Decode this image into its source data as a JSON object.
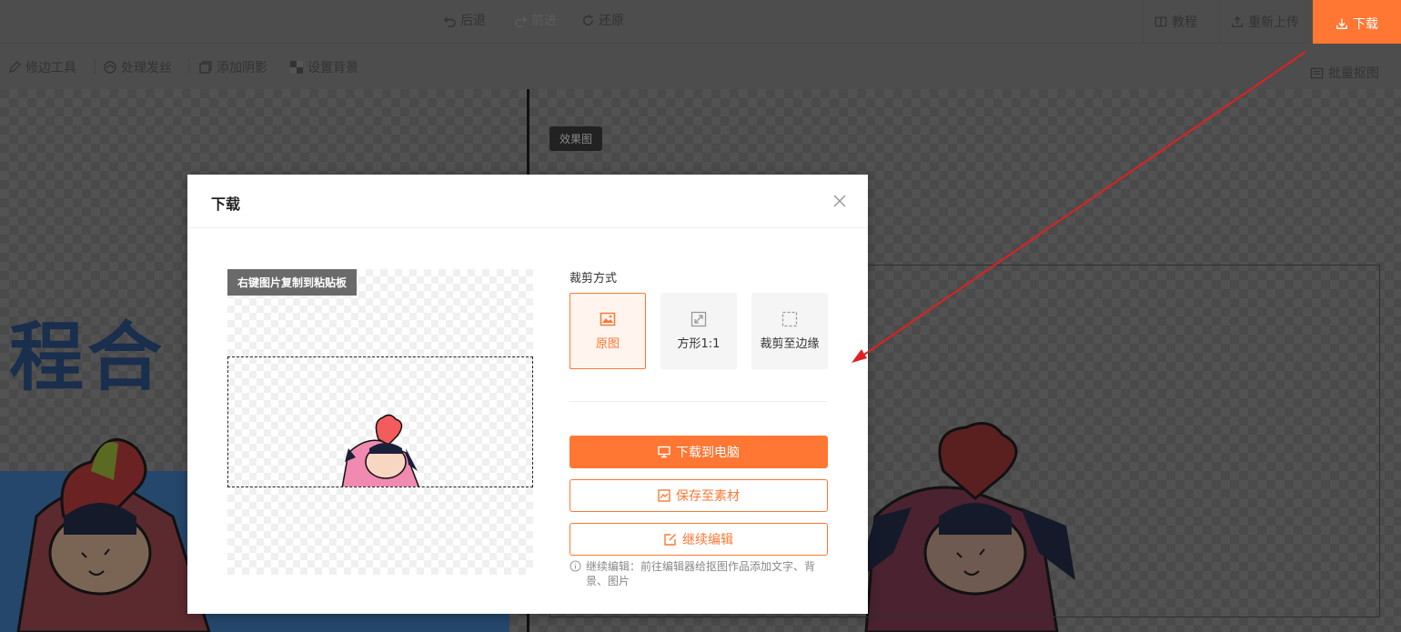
{
  "topbar": {
    "undo_label": "后退",
    "redo_label": "前进",
    "restore_label": "还原",
    "tutorial_label": "教程",
    "reupload_label": "重新上传",
    "download_label": "下载"
  },
  "toolbar": {
    "items": [
      {
        "label": "修边工具",
        "icon": "pencil-icon"
      },
      {
        "label": "处理发丝",
        "icon": "hair-icon"
      },
      {
        "label": "添加阴影",
        "icon": "shadow-icon"
      },
      {
        "label": "设置背景",
        "icon": "checker-icon"
      }
    ],
    "batch_label": "批量抠图"
  },
  "canvas": {
    "effect_tag": "效果图",
    "left_text": "程合"
  },
  "modal": {
    "title": "下载",
    "copy_tip": "右键图片复制到粘贴板",
    "crop_label": "裁剪方式",
    "crop_options": [
      {
        "label": "原图",
        "icon": "image-icon",
        "selected": true
      },
      {
        "label": "方形1:1",
        "icon": "expand-icon",
        "selected": false
      },
      {
        "label": "裁剪至边缘",
        "icon": "dashed-square-icon",
        "selected": false
      }
    ],
    "download_pc_label": "下载到电脑",
    "save_material_label": "保存至素材",
    "continue_edit_label": "继续编辑",
    "note": "继续编辑：前往编辑器给抠图作品添加文字、背景、图片"
  },
  "colors": {
    "accent": "#ff7733",
    "arrow": "#e02020",
    "dark_bg": "#4a4a4a"
  }
}
